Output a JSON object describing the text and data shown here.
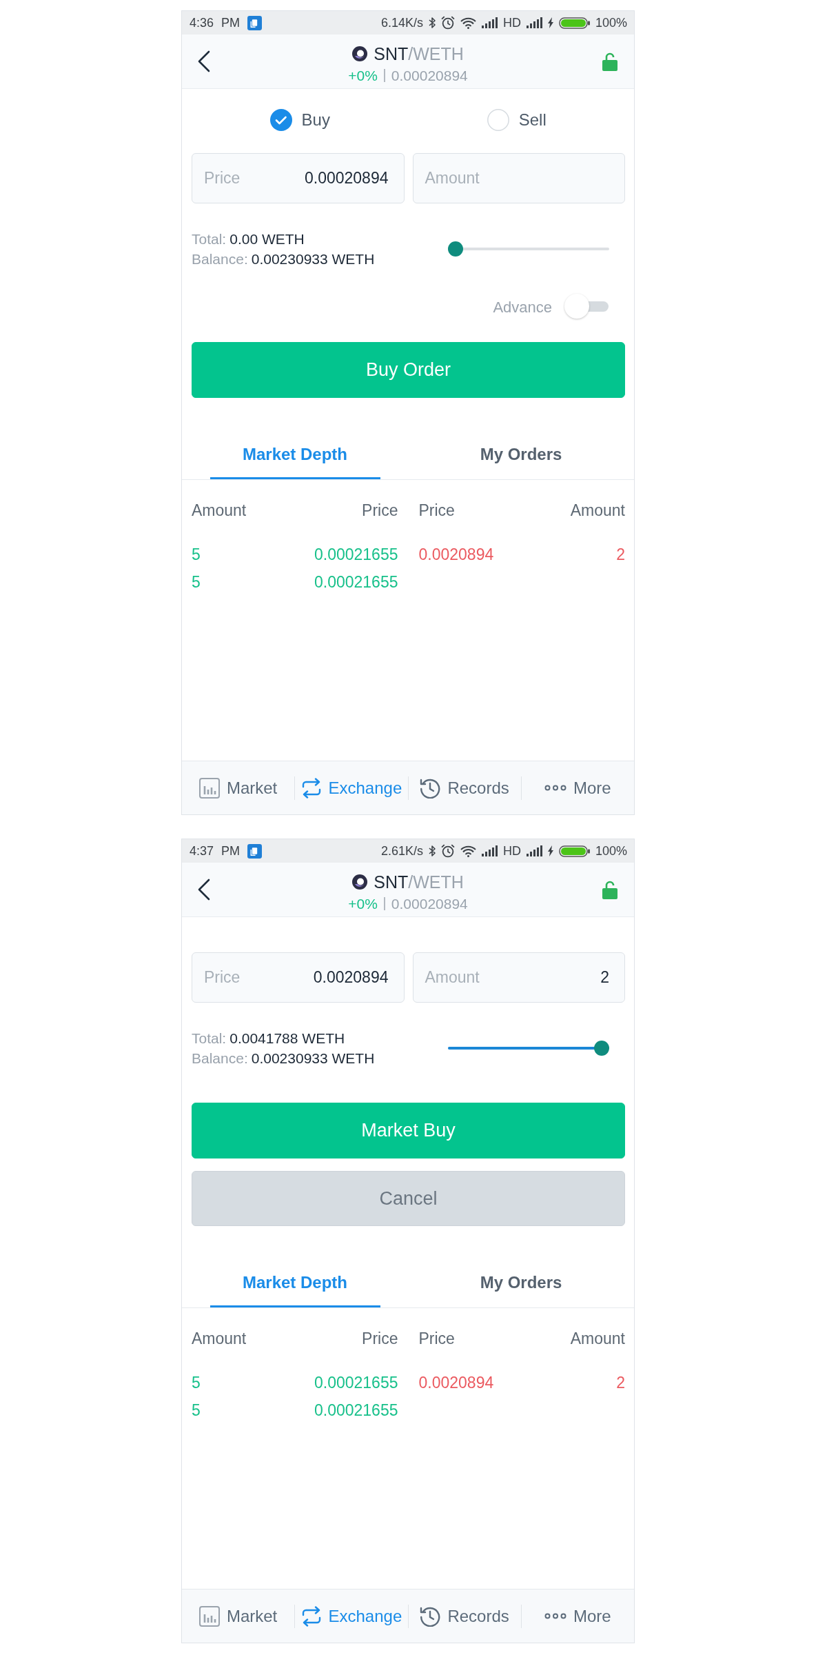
{
  "screens": [
    {
      "status_bar": {
        "time": "4:36 PM",
        "network_speed": "6.14K/s",
        "network_type": "HD",
        "battery": "100%"
      },
      "header": {
        "base": "SNT",
        "quote": "/WETH",
        "change": "+0%",
        "last_price": "0.00020894"
      },
      "side_options": [
        {
          "label": "Buy",
          "selected": true
        },
        {
          "label": "Sell",
          "selected": false
        }
      ],
      "fields": [
        {
          "label": "Price",
          "value": "0.00020894"
        },
        {
          "label": "Amount"
        }
      ],
      "summary": {
        "total_label": "Total:",
        "total_value": "0.00 WETH",
        "balance_label": "Balance:",
        "balance_value": "0.00230933 WETH"
      },
      "slider": {
        "level": 0
      },
      "advance": {
        "label": "Advance",
        "on": false
      },
      "buttons": [
        {
          "label": "Buy Order",
          "disabled": false
        }
      ],
      "tabs": [
        {
          "label": "Market Depth",
          "selected": true
        },
        {
          "label": "My Orders",
          "selected": false
        }
      ],
      "order_book": {
        "columns": [
          "Amount",
          "Price",
          "Price",
          "Amount"
        ],
        "bids": [
          {
            "amount": "5",
            "price": "0.00021655"
          },
          {
            "amount": "5",
            "price": "0.00021655"
          }
        ],
        "asks": [
          {
            "price": "0.0020894",
            "amount": "2"
          }
        ]
      },
      "bottom_nav": [
        {
          "label": "Market",
          "selected": false
        },
        {
          "label": "Exchange",
          "selected": true
        },
        {
          "label": "Records",
          "selected": false
        },
        {
          "label": "More",
          "selected": false
        }
      ]
    },
    {
      "status_bar": {
        "time": "4:37 PM",
        "network_speed": "2.61K/s",
        "network_type": "HD",
        "battery": "100%"
      },
      "header": {
        "base": "SNT",
        "quote": "/WETH",
        "change": "+0%",
        "last_price": "0.00020894"
      },
      "fields": [
        {
          "label": "Price",
          "value": "0.0020894"
        },
        {
          "label": "Amount",
          "value": "2"
        }
      ],
      "summary": {
        "total_label": "Total:",
        "total_value": "0.0041788 WETH",
        "balance_label": "Balance:",
        "balance_value": "0.00230933 WETH"
      },
      "slider": {
        "level": 1
      },
      "buttons": [
        {
          "label": "Market Buy",
          "disabled": false
        },
        {
          "label": "Cancel",
          "disabled": true
        }
      ],
      "tabs": [
        {
          "label": "Market Depth",
          "selected": true
        },
        {
          "label": "My Orders",
          "selected": false
        }
      ],
      "order_book": {
        "columns": [
          "Amount",
          "Price",
          "Price",
          "Amount"
        ],
        "bids": [
          {
            "amount": "5",
            "price": "0.00021655"
          },
          {
            "amount": "5",
            "price": "0.00021655"
          }
        ],
        "asks": [
          {
            "price": "0.0020894",
            "amount": "2"
          }
        ]
      },
      "bottom_nav": [
        {
          "label": "Market",
          "selected": false
        },
        {
          "label": "Exchange",
          "selected": true
        },
        {
          "label": "Records",
          "selected": false
        },
        {
          "label": "More",
          "selected": false
        }
      ]
    }
  ]
}
